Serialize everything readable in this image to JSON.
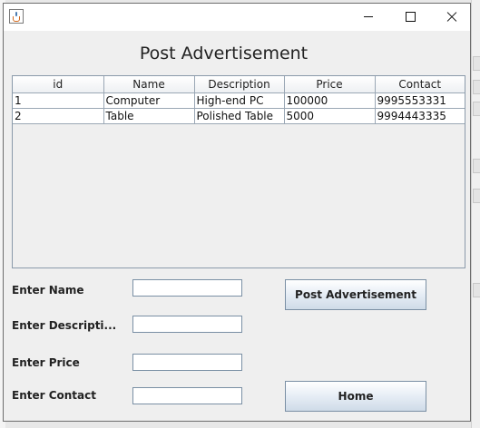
{
  "heading": "Post Advertisement",
  "table": {
    "columns": [
      "id",
      "Name",
      "Description",
      "Price",
      "Contact"
    ],
    "rows": [
      [
        "1",
        "Computer",
        "High-end PC",
        "100000",
        "9995553331"
      ],
      [
        "2",
        "Table",
        "Polished Table",
        "5000",
        "9994443335"
      ]
    ]
  },
  "form": {
    "name_label": "Enter Name",
    "description_label": "Enter Descripti...",
    "price_label": "Enter Price",
    "contact_label": "Enter Contact",
    "name_value": "",
    "description_value": "",
    "price_value": "",
    "contact_value": ""
  },
  "buttons": {
    "post": "Post Advertisement",
    "home": "Home"
  }
}
